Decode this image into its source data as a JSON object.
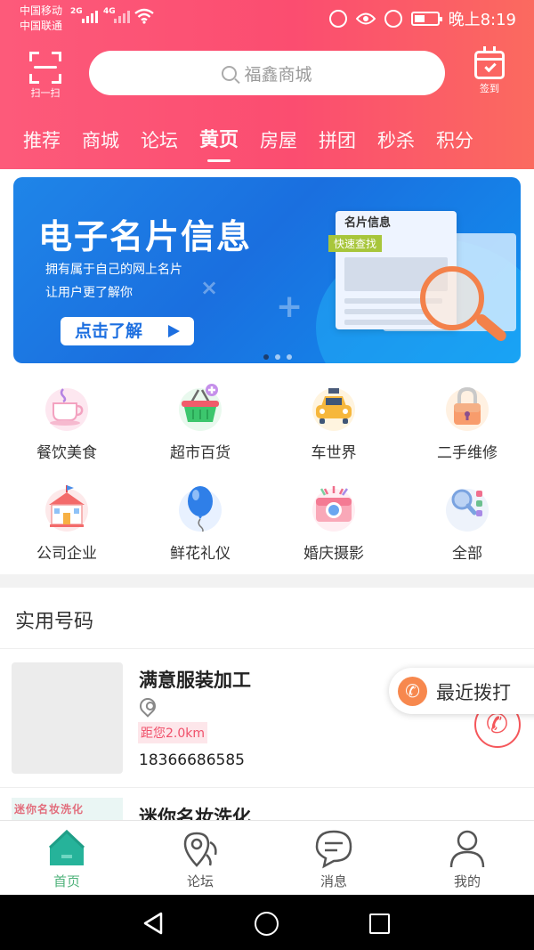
{
  "status_bar": {
    "carrier1": "中国移动",
    "carrier2": "中国联通",
    "net1": "2G",
    "net2": "4G",
    "time": "晚上8:19"
  },
  "header": {
    "scan_label": "扫一扫",
    "search_placeholder": "福鑫商城",
    "signin_label": "签到"
  },
  "tabs": [
    {
      "label": "推荐"
    },
    {
      "label": "商城"
    },
    {
      "label": "论坛"
    },
    {
      "label": "黄页",
      "active": true
    },
    {
      "label": "房屋"
    },
    {
      "label": "拼团"
    },
    {
      "label": "秒杀"
    },
    {
      "label": "积分"
    }
  ],
  "banner": {
    "title": "电子名片信息",
    "subtitle1": "拥有属于自己的网上名片",
    "subtitle2": "让用户更了解你",
    "button_label": "点击了解",
    "card_title": "名片信息",
    "card_tag": "快速查找",
    "active_dot": 0,
    "dot_count": 3
  },
  "categories": [
    {
      "label": "餐饮美食",
      "icon": "coffee-cup-icon"
    },
    {
      "label": "超市百货",
      "icon": "shopping-basket-icon"
    },
    {
      "label": "车世界",
      "icon": "taxi-icon"
    },
    {
      "label": "二手维修",
      "icon": "padlock-icon"
    },
    {
      "label": "公司企业",
      "icon": "building-icon"
    },
    {
      "label": "鲜花礼仪",
      "icon": "balloon-icon"
    },
    {
      "label": "婚庆摄影",
      "icon": "camera-icon"
    },
    {
      "label": "全部",
      "icon": "all-apps-icon"
    }
  ],
  "useful_numbers": {
    "title": "实用号码",
    "items": [
      {
        "name": "满意服装加工",
        "distance": "距您2.0km",
        "phone": "18366686585"
      },
      {
        "name": "迷你名妆洗化",
        "thumb_text": "迷你名妆洗化"
      }
    ],
    "recent_call_label": "最近拨打"
  },
  "bottom_nav": [
    {
      "label": "首页",
      "icon": "home-icon",
      "active": true
    },
    {
      "label": "论坛",
      "icon": "map-pin-icon"
    },
    {
      "label": "消息",
      "icon": "chat-bubble-icon"
    },
    {
      "label": "我的",
      "icon": "user-icon"
    }
  ],
  "colors": {
    "header_start": "#fd5a7a",
    "header_end": "#fb6a5f",
    "accent_green": "#4eb27a",
    "distance_red": "#f0506a",
    "banner_blue": "#1a6fdf"
  }
}
